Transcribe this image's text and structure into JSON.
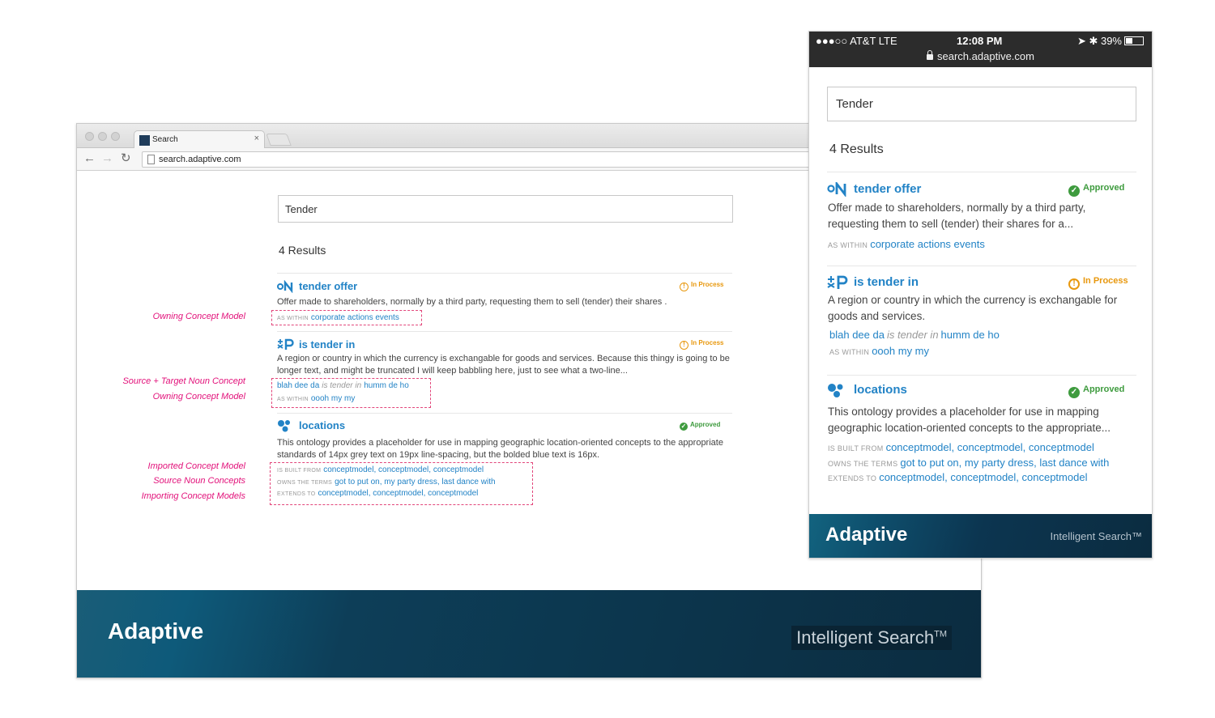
{
  "desktop": {
    "tab_title": "Search",
    "tab_close": "×",
    "url": "search.adaptive.com",
    "search_value": "Tender",
    "results_count": "4 Results",
    "footer_logo": "Adaptive",
    "footer_tagline": "Intelligent Search",
    "footer_tm": "TM"
  },
  "mobile": {
    "carrier": "●●●○○ AT&T  LTE",
    "time": "12:08 PM",
    "battery": "39%",
    "battery_level": 0.39,
    "status_icons": "➤ ✱",
    "url": "search.adaptive.com",
    "search_value": "Tender",
    "results_count": "4 Results",
    "footer_logo": "Adaptive",
    "footer_tagline": "Intelligent Search™"
  },
  "results": {
    "r1": {
      "type_icon": "noun-concept-icon",
      "type_text": "⚬N",
      "title": "tender offer",
      "status": "Approved",
      "status_desktop": "In Process",
      "desc_desktop": "Offer made to shareholders, normally by a third party, requesting them to sell (tender) their shares .",
      "desc_mobile": "Offer made to shareholders, normally by a third party, requesting them to sell (tender) their shares for a...",
      "as_within_label": "AS WITHIN",
      "as_within": "corporate actions events"
    },
    "r2": {
      "type_icon": "predicate-icon",
      "type_text": "⁑P",
      "title": "is tender in",
      "status": "In Process",
      "desc_desktop": "A region or country in which the currency is exchangable for goods and services. Because this thingy is going to be longer text, and might be truncated I will keep babbling here, just to see what a two-line...",
      "desc_mobile": "A region or country in which the currency is exchangable for goods and services.",
      "source": "blah dee da",
      "predicate": "is tender in",
      "target": "humm de ho",
      "as_within_label": "AS WITHIN",
      "as_within": "oooh my my"
    },
    "r3": {
      "type_icon": "ontology-icon",
      "title": "locations",
      "status": "Approved",
      "desc_desktop": "This ontology provides a placeholder for use in mapping geographic location-oriented concepts to the appropriate standards of 14px grey text on 19px line-spacing, but the bolded blue text is 16px.",
      "desc_mobile": "This ontology provides a placeholder for use in mapping geographic location-oriented concepts to the appropriate...",
      "built_from_label": "IS BUILT FROM",
      "built_from": "conceptmodel, conceptmodel, conceptmodel",
      "owns_terms_label": "OWNS THE TERMS",
      "owns_terms": "got to put on, my party dress, last dance with",
      "extends_label": "EXTENDS TO",
      "extends": "conceptmodel, conceptmodel, conceptmodel"
    }
  },
  "annotations": {
    "owning_model": "Owning Concept Model",
    "source_target": "Source + Target Noun Concept",
    "owning_model_2": "Owning Concept Model",
    "imported_model": "Imported Concept Model",
    "source_noun": "Source Noun Concepts",
    "importing_models": "Importing Concept Models"
  },
  "colors": {
    "link_blue": "#2283c6",
    "approved_green": "#3e9b3e",
    "in_process_orange": "#e8980e",
    "annotation_pink": "#e2117a",
    "footer_dark": "#0b2c40"
  }
}
